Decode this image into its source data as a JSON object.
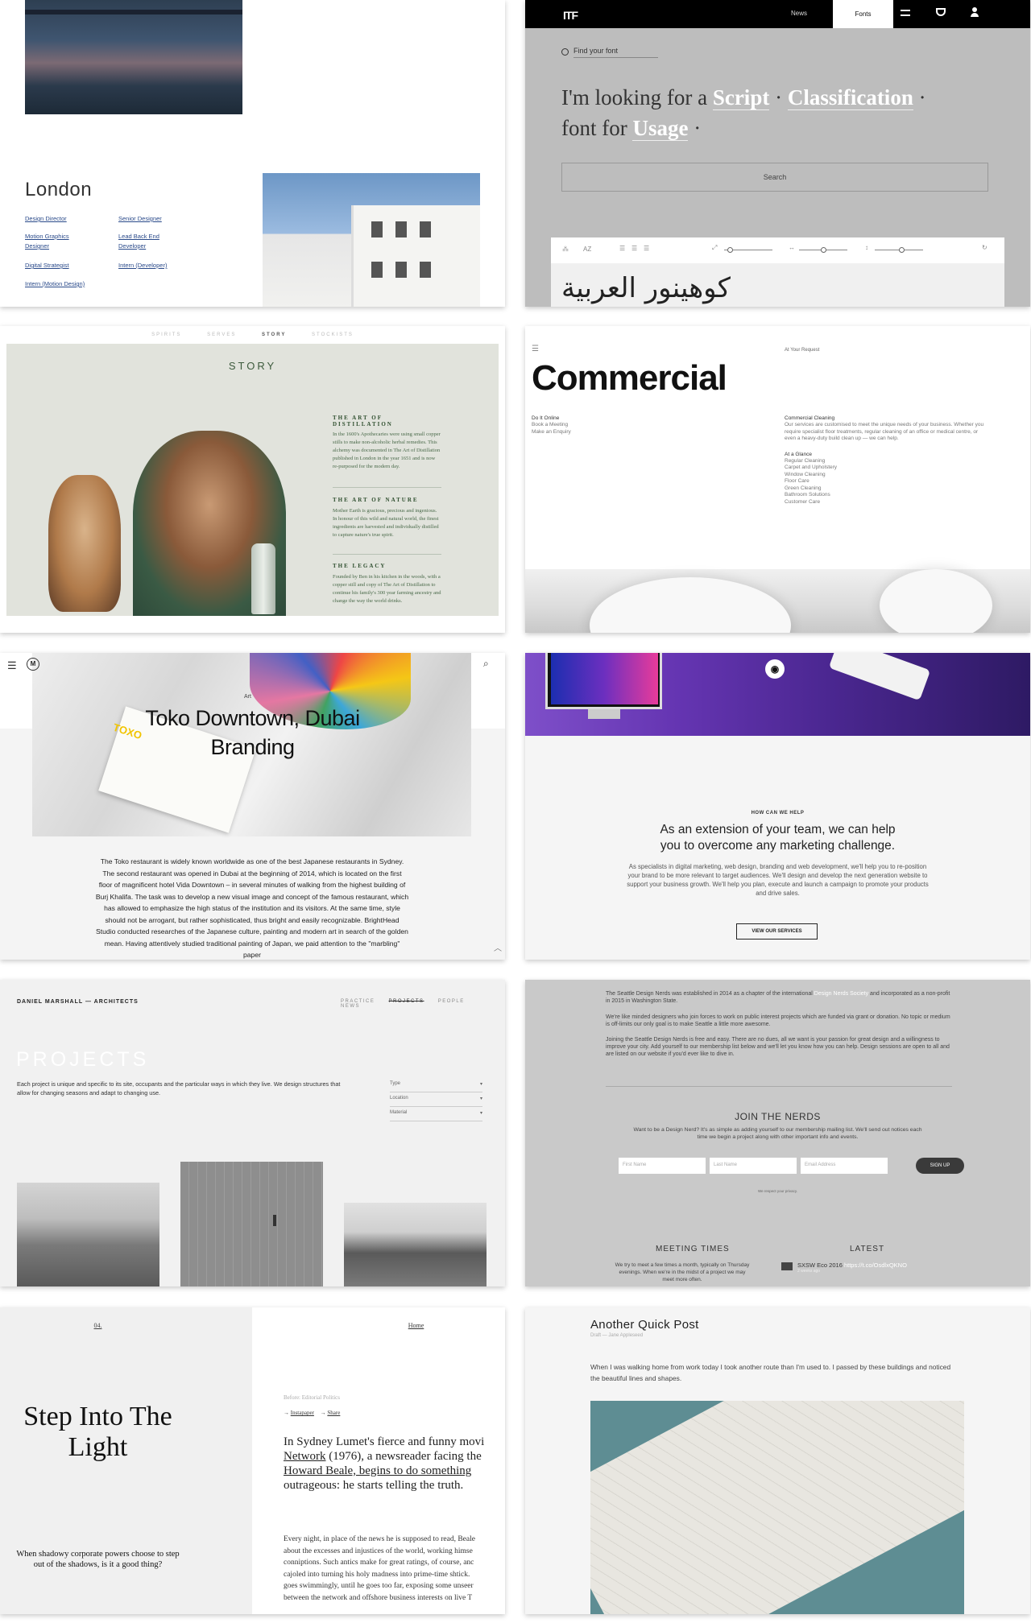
{
  "london": {
    "city": "London",
    "jobs_col1": [
      "Design Director",
      "Motion Graphics",
      "Designer",
      "Digital Strategist",
      "Intern (Motion Design)"
    ],
    "jobs_col2": [
      "Senior Designer",
      "Lead Back End",
      "Developer",
      "Intern (Developer)"
    ]
  },
  "fonts": {
    "nav": {
      "news": "News",
      "fonts": "Fonts"
    },
    "find_placeholder": "Find your font",
    "headline_prefix": "I'm looking for a",
    "script": "Script",
    "classification": "Classification",
    "font_for": "font for",
    "usage": "Usage",
    "search_label": "Search",
    "specimen": "كوهينور العربية",
    "toolbar_text": "AZ"
  },
  "story": {
    "tabs": [
      "SPIRITS",
      "SERVES",
      "STORY",
      "STOCKISTS"
    ],
    "active_tab": "STORY",
    "title": "STORY",
    "sections": [
      {
        "heading": "THE ART OF",
        "heading2": "DISTILLATION",
        "text": "In the 1600's Apothecaries were using small copper stills to make non-alcoholic herbal remedies. This alchemy was documented in The Art of Distillation published in London in the year 1651 and is now re-purposed for the modern day."
      },
      {
        "heading": "THE ART OF NATURE",
        "heading2": "",
        "text": "Mother Earth is gracious, precious and ingenious. In honour of this wild and natural world, the finest ingredients are harvested and individually distilled to capture nature's true spirit."
      },
      {
        "heading": "THE LEGACY",
        "heading2": "",
        "text": "Founded by Ben in his kitchen in the woods, with a copper still and copy of The Art of Distillation to continue his family's 300 year farming ancestry and change the way the world drinks."
      }
    ]
  },
  "commercial": {
    "request": "At Your Request",
    "title": "Commercial",
    "left_links": [
      "Do It Online",
      "Book a Meeting",
      "Make an Enquiry"
    ],
    "cleaning_head": "Commercial Cleaning",
    "cleaning_text": "Our services are customised to meet the unique needs of your business. Whether you require specialist floor treatments, regular cleaning of an office or medical centre, or even a heavy-duty build clean up — we can help.",
    "glance_head": "At a Glance",
    "glance_items": [
      "Regular Cleaning",
      "Carpet and Upholstery",
      "Window Cleaning",
      "Floor Care",
      "Green Cleaning",
      "Bathroom Solutions",
      "Customer Care"
    ]
  },
  "toko": {
    "logo_letter": "M",
    "category": "Art",
    "title_line1": "Toko Downtown, Dubai",
    "title_line2": "Branding",
    "card_brand": "TOXO",
    "body": "The Toko restaurant is widely known worldwide as one of the best Japanese restaurants in Sydney. The second restaurant was opened in Dubai at the beginning of 2014, which is located on the first floor of magnificent hotel Vida Downtown – in several minutes of walking from the highest building of Burj Khalifa. The task was to develop a new visual image and concept of the famous restaurant, which has allowed to emphasize the high status of the institution and its visitors. At the same time, style should not be arrogant, but rather sophisticated, thus bright and easily recognizable. BrightHead Studio conducted researches of the Japanese culture, painting and modern art in search of the golden mean. Having attentively studied traditional painting of Japan, we paid attention to the \"marbling\" paper"
  },
  "marketing": {
    "kicker": "HOW CAN WE HELP",
    "headline": "As an extension of your team, we can help you to overcome any marketing challenge.",
    "paragraph": "As specialists in digital marketing, web design, branding and web development, we'll help you to re-position your brand to be more relevant to target audiences. We'll design and develop the next generation website to support your business growth. We'll help you plan, execute and launch a campaign to promote your products and drive sales.",
    "button": "VIEW OUR SERVICES"
  },
  "architects": {
    "brand": "DANIEL MARSHALL — ARCHITECTS",
    "nav": [
      "PRACTICE",
      "PROJECTS",
      "PEOPLE",
      "NEWS"
    ],
    "current": "PROJECTS",
    "title": "PROJECTS",
    "description": "Each project is unique and specific to its site, occupants and the particular ways in which they live. We design structures that allow for changing seasons and adapt to changing use.",
    "filters": [
      "Type",
      "Location",
      "Material"
    ]
  },
  "nerds": {
    "p1_a": "The Seattle Design Nerds was established in 2014 as a chapter of the international",
    "p1_link": "Design Nerds Society",
    "p1_b": "and incorporated as a non-profit in 2015 in Washington State.",
    "p2": "We're like minded designers who join forces to work on public interest projects which are funded via grant or donation. No topic or medium is off-limits our only goal is to make Seattle a little more awesome.",
    "p3": "Joining the Seattle Design Nerds is free and easy. There are no dues, all we want is your passion for great design and a willingness to improve your city. Add yourself to our membership list below and we'll let you know how you can help. Design sessions are open to all and are listed on our website if you'd ever like to dive in.",
    "join_title": "JOIN THE NERDS",
    "join_text": "Want to be a Design Nerd? It's as simple as adding yourself to our membership mailing list. We'll send out notices each time we begin a project along with other important info and events.",
    "first_name": "First Name",
    "last_name": "Last Name",
    "email": "Email Address",
    "signup": "SIGN UP",
    "spam_note": "We respect your privacy.",
    "meeting_title": "MEETING TIMES",
    "latest_title": "LATEST",
    "meeting_text": "We try to meet a few times a month, typically on Thursday evenings. When we're in the midst of a project we may meet more often.",
    "tweet": "SXSW Eco 2016",
    "tweet_link": "https://t.co/OsdlxQKNO",
    "tweet_time": "2 weeks ago"
  },
  "stepinto": {
    "number": "04.",
    "title": "Step Into The Light",
    "quote": "When shadowy corporate powers choose to step out of the shadows, is it a good thing?",
    "home": "Home",
    "before": "Before: Editorial Politics",
    "share": [
      "Instapaper",
      "Share"
    ],
    "lede_a": "In Sydney Lumet's fierce and funny movi",
    "lede_link": "Network",
    "lede_b": " (1976), a newsreader facing the",
    "lede_c": "Howard Beale, begins to do something",
    "lede_d": "outrageous: he starts telling the truth.",
    "body": [
      "Every night, in place of the news he is supposed to read, Beale",
      "about the excesses and injustices of the world, working himse",
      "conniptions. Such antics make for great ratings, of course, anc",
      "cajoled into turning his holy madness into prime-time shtick.",
      "goes swimmingly, until he goes too far, exposing some unseer",
      "between the network and offshore business interests on live T"
    ]
  },
  "quickpost": {
    "title": "Another Quick Post",
    "meta": "Draft — Jane Appleseed",
    "body": "When I was walking home from work today I took another route than I'm used to. I passed by these buildings and noticed the beautiful lines and shapes."
  }
}
